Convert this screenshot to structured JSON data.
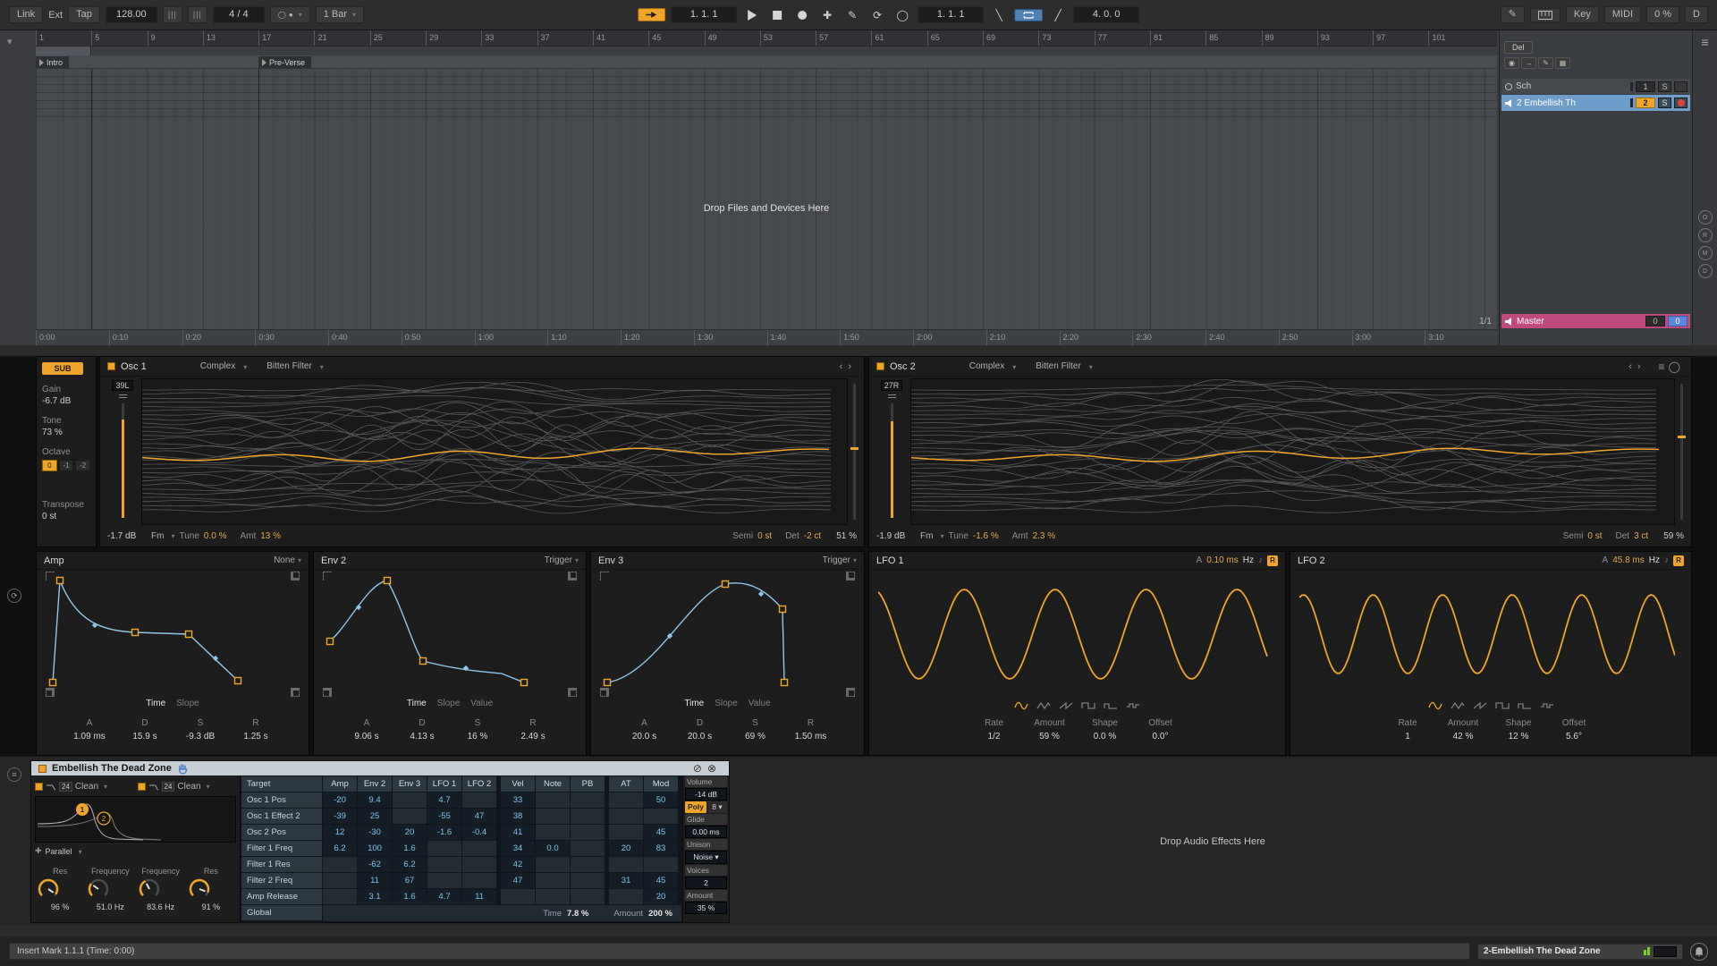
{
  "transport": {
    "link": "Link",
    "ext": "Ext",
    "tap": "Tap",
    "tempo": "128.00",
    "sig": "4 / 4",
    "quantize": "1 Bar",
    "pos": "1. 1. 1",
    "punch": "1. 1. 1",
    "loop_len": "4. 0. 0",
    "key": "Key",
    "midi": "MIDI",
    "cpu": "0 %",
    "disk": "D"
  },
  "arrangement": {
    "bars": [
      "1",
      "5",
      "9",
      "13",
      "17",
      "21",
      "25",
      "29",
      "33",
      "37",
      "41",
      "45",
      "49",
      "53",
      "57",
      "61",
      "65",
      "69",
      "73",
      "77",
      "81",
      "85",
      "89",
      "93",
      "97",
      "101"
    ],
    "times": [
      "0:00",
      "0:10",
      "0:20",
      "0:30",
      "0:40",
      "0:50",
      "1:00",
      "1:10",
      "1:20",
      "1:30",
      "1:40",
      "1:50",
      "2:00",
      "2:10",
      "2:20",
      "2:30",
      "2:40",
      "2:50",
      "3:00",
      "3:10"
    ],
    "locator1": "Intro",
    "locator2": "Pre-Verse",
    "drop_text": "Drop Files and Devices Here",
    "zoom": "1/1",
    "del": "Del",
    "track1": {
      "name": "Sch",
      "num": "1",
      "solo": "S"
    },
    "track2": {
      "name": "2 Embellish Th",
      "num": "2",
      "solo": "S"
    },
    "master": {
      "name": "Master",
      "v1": "0",
      "v2": "0"
    }
  },
  "wavetable": {
    "sub": {
      "label": "SUB",
      "gain_l": "Gain",
      "gain": "-6.7 dB",
      "tone_l": "Tone",
      "tone": "73 %",
      "oct_l": "Octave",
      "oct": [
        "0",
        "-1",
        "-2"
      ],
      "trans_l": "Transpose",
      "trans": "0 st"
    },
    "osc1": {
      "title": "Osc 1",
      "cat": "Complex",
      "table": "Bitten Filter",
      "pan": "39L",
      "gain": "-1.7 dB",
      "mod": "Fm",
      "tune_l": "Tune",
      "tune": "0.0 %",
      "amt_l": "Amt",
      "amt": "13 %",
      "semi_l": "Semi",
      "semi": "0 st",
      "det_l": "Det",
      "det": "-2 ct",
      "pos": "51 %"
    },
    "osc2": {
      "title": "Osc 2",
      "cat": "Complex",
      "table": "Bitten Filter",
      "pan": "27R",
      "gain": "-1.9 dB",
      "mod": "Fm",
      "tune_l": "Tune",
      "tune": "-1.6 %",
      "amt_l": "Amt",
      "amt": "2.3 %",
      "semi_l": "Semi",
      "semi": "0 st",
      "det_l": "Det",
      "det": "3 ct",
      "pos": "59 %"
    },
    "amp": {
      "title": "Amp",
      "mode": "None",
      "tabs": [
        "Time",
        "Slope"
      ],
      "params": [
        {
          "l": "A",
          "v": "1.09 ms"
        },
        {
          "l": "D",
          "v": "15.9 s"
        },
        {
          "l": "S",
          "v": "-9.3 dB"
        },
        {
          "l": "R",
          "v": "1.25 s"
        }
      ]
    },
    "env2": {
      "title": "Env 2",
      "mode": "Trigger",
      "tabs": [
        "Time",
        "Slope",
        "Value"
      ],
      "params": [
        {
          "l": "A",
          "v": "9.06 s"
        },
        {
          "l": "D",
          "v": "4.13 s"
        },
        {
          "l": "S",
          "v": "16 %"
        },
        {
          "l": "R",
          "v": "2.49 s"
        }
      ]
    },
    "env3": {
      "title": "Env 3",
      "mode": "Trigger",
      "tabs": [
        "Time",
        "Slope",
        "Value"
      ],
      "params": [
        {
          "l": "A",
          "v": "20.0 s"
        },
        {
          "l": "D",
          "v": "20.0 s"
        },
        {
          "l": "S",
          "v": "69 %"
        },
        {
          "l": "R",
          "v": "1.50 ms"
        }
      ]
    },
    "lfo1": {
      "title": "LFO 1",
      "atk_l": "A",
      "atk": "0.10 ms",
      "hz": "Hz",
      "note_icon": "♪",
      "retrig": "R",
      "params": [
        {
          "l": "Rate",
          "v": "1/2"
        },
        {
          "l": "Amount",
          "v": "59 %"
        },
        {
          "l": "Shape",
          "v": "0.0 %"
        },
        {
          "l": "Offset",
          "v": "0.0°"
        }
      ]
    },
    "lfo2": {
      "title": "LFO 2",
      "atk_l": "A",
      "atk": "45.8 ms",
      "hz": "Hz",
      "note_icon": "♪",
      "retrig": "R",
      "params": [
        {
          "l": "Rate",
          "v": "1"
        },
        {
          "l": "Amount",
          "v": "42 %"
        },
        {
          "l": "Shape",
          "v": "12 %"
        },
        {
          "l": "Offset",
          "v": "5.6°"
        }
      ]
    }
  },
  "device": {
    "title": "Embellish The Dead Zone",
    "filter": {
      "f1_slope": "24",
      "f1_type": "Clean",
      "f2_slope": "24",
      "f2_type": "Clean",
      "f1_num": "1",
      "f2_num": "2",
      "routing": "Parallel",
      "res1_l": "Res",
      "res1": "96 %",
      "freq1_l": "Frequency",
      "freq1": "51.0 Hz",
      "freq2_l": "Frequency",
      "freq2": "83.6 Hz",
      "res2_l": "Res",
      "res2": "91 %"
    },
    "matrix": {
      "target": "Target",
      "columns": [
        "Amp",
        "Env 2",
        "Env 3",
        "LFO 1",
        "LFO 2",
        "Vel",
        "Note",
        "PB",
        "AT",
        "Mod"
      ],
      "rows": [
        {
          "target": "Osc 1 Pos",
          "cells": [
            "-20",
            "9.4",
            "",
            "4.7",
            "",
            "33",
            "",
            "",
            "",
            "50"
          ]
        },
        {
          "target": "Osc 1 Effect 2",
          "cells": [
            "-39",
            "25",
            "",
            "-55",
            "47",
            "38",
            "",
            "",
            "",
            ""
          ]
        },
        {
          "target": "Osc 2 Pos",
          "cells": [
            "12",
            "-30",
            "20",
            "-1.6",
            "-0.4",
            "41",
            "",
            "",
            "",
            "45"
          ]
        },
        {
          "target": "Filter 1 Freq",
          "cells": [
            "6.2",
            "100",
            "1.6",
            "",
            "",
            "34",
            "0.0",
            "",
            "20",
            "83"
          ]
        },
        {
          "target": "Filter 1 Res",
          "cells": [
            "",
            "-62",
            "6.2",
            "",
            "",
            "42",
            "",
            "",
            "",
            ""
          ]
        },
        {
          "target": "Filter 2 Freq",
          "cells": [
            "",
            "11",
            "67",
            "",
            "",
            "47",
            "",
            "",
            "31",
            "45"
          ]
        },
        {
          "target": "Amp Release",
          "cells": [
            "",
            "3.1",
            "1.6",
            "4.7",
            "11",
            "",
            "",
            "",
            "",
            "20"
          ]
        }
      ],
      "global": "Global",
      "time_l": "Time",
      "time": "7.8 %",
      "amount_l": "Amount",
      "amount": "200 %"
    },
    "params": {
      "volume_l": "Volume",
      "volume": "-14 dB",
      "poly": "Poly",
      "poly_n": "8 ▾",
      "glide_l": "Glide",
      "glide": "0.00 ms",
      "unison_l": "Unison",
      "unison": "Noise ▾",
      "voices_l": "Voices",
      "voices": "2",
      "amount_l": "Amount",
      "amount": "35 %"
    },
    "drop_text": "Drop Audio Effects Here"
  },
  "status": {
    "left": "Insert Mark 1.1.1 (Time: 0:00)",
    "track": "2-Embellish The Dead Zone"
  }
}
